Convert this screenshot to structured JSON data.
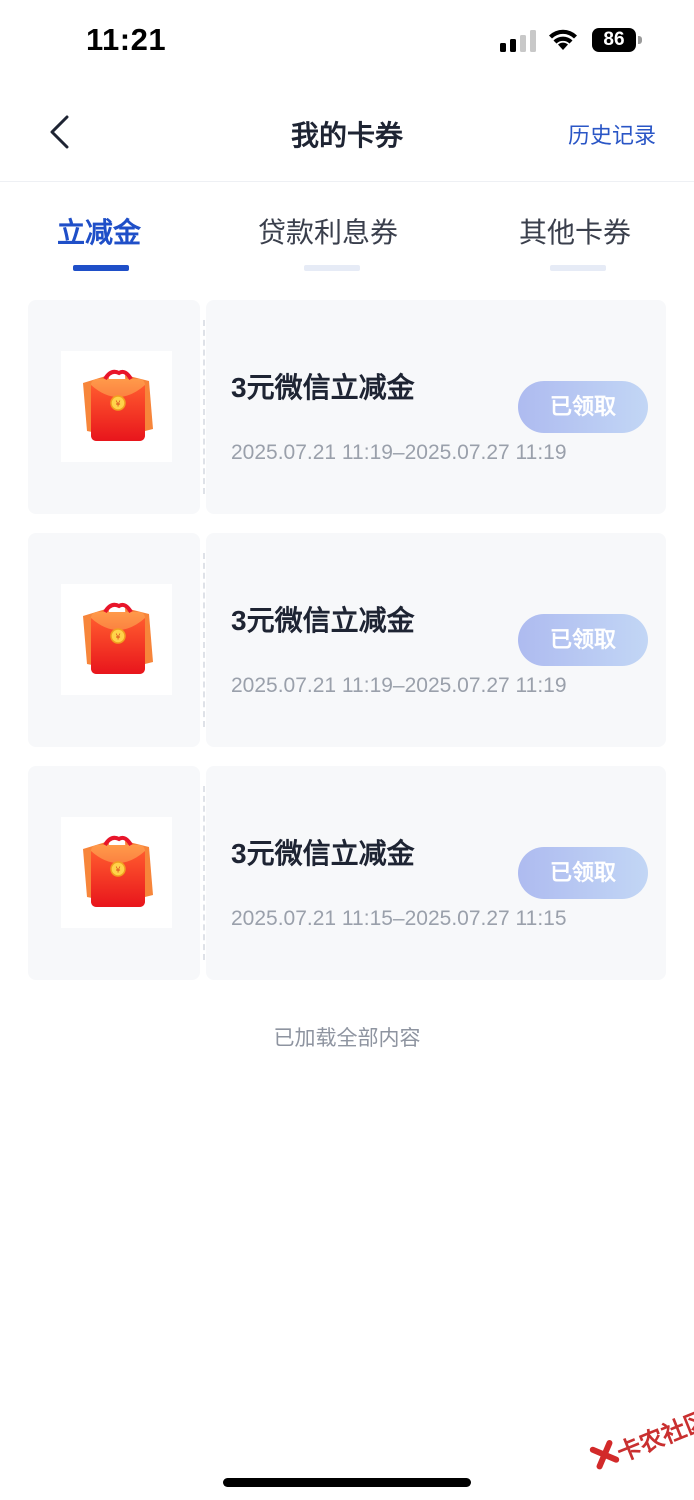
{
  "status_bar": {
    "time": "11:21",
    "battery": "86"
  },
  "nav": {
    "title": "我的卡券",
    "history": "历史记录"
  },
  "tabs": [
    {
      "label": "立减金",
      "active": true
    },
    {
      "label": "贷款利息券",
      "active": false
    },
    {
      "label": "其他卡券",
      "active": false
    }
  ],
  "coupons": [
    {
      "title": "3元微信立减金",
      "validity": "2025.07.21 11:19–2025.07.27 11:19",
      "status": "已领取",
      "icon": "red-envelope-icon"
    },
    {
      "title": "3元微信立减金",
      "validity": "2025.07.21 11:19–2025.07.27 11:19",
      "status": "已领取",
      "icon": "red-envelope-icon"
    },
    {
      "title": "3元微信立减金",
      "validity": "2025.07.21 11:15–2025.07.27 11:15",
      "status": "已领取",
      "icon": "red-envelope-icon"
    }
  ],
  "footer": "已加载全部内容",
  "watermark": "卡农社区",
  "colors": {
    "accent": "#1f4fc8",
    "claimed_button": "#b4c4f0",
    "card_bg": "#f7f8fa"
  }
}
